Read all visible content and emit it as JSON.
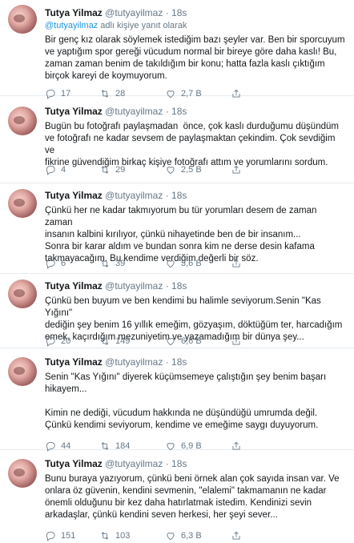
{
  "tweets": [
    {
      "name": "Tutya Yilmaz",
      "handle": "@tutyayilmaz",
      "dot": "·",
      "time": "18s",
      "replying_mention": "@tutyayilmaz",
      "replying_suffix": " adlı kişiye yanıt olarak",
      "text": "Bir genç kız olarak söylemek istediğim bazı şeyler var. Ben bir sporcuyum\nve yaptığım spor gereği vücudum normal bir bireye göre daha kaslı! Bu,\nzaman zaman benim de takıldığım bir konu; hatta fazla kaslı çıktığım\nbirçok kareyi de koymuyorum.",
      "replies": "17",
      "retweets": "28",
      "likes": "2,7 B"
    },
    {
      "name": "Tutya Yilmaz",
      "handle": "@tutyayilmaz",
      "dot": "·",
      "time": "18s",
      "text": "Bugün bu fotoğrafı paylaşmadan  önce, çok kaslı durduğumu düşündüm\nve fotoğrafı ne kadar sevsem de paylaşmaktan çekindim. Çok sevdiğim ve\nfikrine güvendiğim birkaç kişiye fotoğrafı attım ve yorumlarını sordum.",
      "replies": "4",
      "retweets": "29",
      "likes": "2,5 B"
    },
    {
      "name": "Tutya Yilmaz",
      "handle": "@tutyayilmaz",
      "dot": "·",
      "time": "18s",
      "text": "Çünkü her ne kadar takmıyorum bu tür yorumları desem de zaman zaman\ninsanın kalbini kırılıyor, çünkü nihayetinde ben de bir insanım...\nSonra bir karar aldım ve bundan sonra kim ne derse desin kafama\ntakmayacağım. Bu kendime verdiğim değerli bir söz.",
      "replies": "6",
      "retweets": "39",
      "likes": "3,6 B"
    },
    {
      "name": "Tutya Yilmaz",
      "handle": "@tutyayilmaz",
      "dot": "·",
      "time": "18s",
      "text": "Çünkü ben buyum ve ben kendimi bu halimle seviyorum.Senin \"Kas Yığını\"\ndediğin şey benim 16 yıllık emeğim, gözyaşım, döktüğüm ter, harcadığım\nemek, kaçırdığım mezuniyetim ve yazamadığım bir dünya şey...",
      "replies": "20",
      "retweets": "149",
      "likes": "6,6 B"
    },
    {
      "name": "Tutya Yilmaz",
      "handle": "@tutyayilmaz",
      "dot": "·",
      "time": "18s",
      "text": "Senin \"Kas Yığını\" diyerek küçümsemeye çalıştığın şey benim başarı\nhikayem...\n\nKimin ne dediği, vücudum hakkında ne düşündüğü umrumda değil.\nÇünkü kendimi seviyorum, kendime ve emeğime saygı duyuyorum.",
      "replies": "44",
      "retweets": "184",
      "likes": "6,9 B"
    },
    {
      "name": "Tutya Yilmaz",
      "handle": "@tutyayilmaz",
      "dot": "·",
      "time": "18s",
      "text": "Bunu buraya yazıyorum, çünkü beni örnek alan çok sayıda insan var. Ve\nonlara öz güvenin, kendini sevmenin, \"elalemi\" takmamanın ne kadar\nönemli olduğunu bir kez daha hatırlatmak istedim. Kendinizi sevin\narkadaşlar, çünkü kendini seven herkesi, her şeyi sever...",
      "replies": "151",
      "retweets": "103",
      "likes": "6,3 B"
    }
  ],
  "icons": {
    "reply": "reply-icon",
    "retweet": "retweet-icon",
    "like": "heart-icon",
    "share": "share-icon"
  },
  "colors": {
    "link": "#1b95e0",
    "muted": "#657786",
    "text": "#14171a",
    "divider": "#e6ecf0"
  }
}
